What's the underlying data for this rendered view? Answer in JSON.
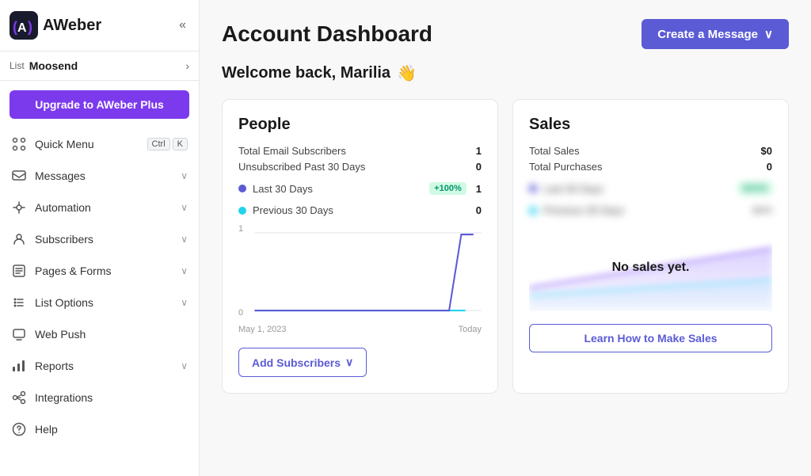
{
  "app": {
    "name": "AWeber"
  },
  "sidebar": {
    "list_label": "List",
    "list_name": "Moosend",
    "upgrade_btn": "Upgrade to AWeber Plus",
    "collapse_title": "Collapse sidebar",
    "items": [
      {
        "id": "quick-menu",
        "label": "Quick Menu",
        "shortcut": [
          "Ctrl",
          "K"
        ],
        "has_chevron": false
      },
      {
        "id": "messages",
        "label": "Messages",
        "has_chevron": true
      },
      {
        "id": "automation",
        "label": "Automation",
        "has_chevron": true
      },
      {
        "id": "subscribers",
        "label": "Subscribers",
        "has_chevron": true
      },
      {
        "id": "pages-forms",
        "label": "Pages & Forms",
        "has_chevron": true
      },
      {
        "id": "list-options",
        "label": "List Options",
        "has_chevron": true
      },
      {
        "id": "web-push",
        "label": "Web Push",
        "has_chevron": false
      },
      {
        "id": "reports",
        "label": "Reports",
        "has_chevron": true
      },
      {
        "id": "integrations",
        "label": "Integrations",
        "has_chevron": false
      },
      {
        "id": "help",
        "label": "Help",
        "has_chevron": false
      }
    ]
  },
  "header": {
    "title": "Account Dashboard",
    "create_btn": "Create a Message"
  },
  "welcome": {
    "text": "Welcome back, Marilia",
    "emoji": "👋"
  },
  "people_card": {
    "title": "People",
    "stats": [
      {
        "label": "Total Email Subscribers",
        "value": "1"
      },
      {
        "label": "Unsubscribed Past 30 Days",
        "value": "0"
      }
    ],
    "legend": [
      {
        "label": "Last 30 Days",
        "color": "#5b5bd6",
        "badge": "+100%",
        "count": "1"
      },
      {
        "label": "Previous 30 Days",
        "color": "#22d3ee",
        "count": "0"
      }
    ],
    "chart": {
      "y_top": "1",
      "y_bottom": "0",
      "x_start": "May 1, 2023",
      "x_end": "Today"
    },
    "add_btn": "Add Subscribers"
  },
  "sales_card": {
    "title": "Sales",
    "stats": [
      {
        "label": "Total Sales",
        "value": "$0"
      },
      {
        "label": "Total Purchases",
        "value": "0"
      }
    ],
    "no_sales_text": "No sales yet.",
    "learn_btn": "Learn How to Make Sales"
  }
}
